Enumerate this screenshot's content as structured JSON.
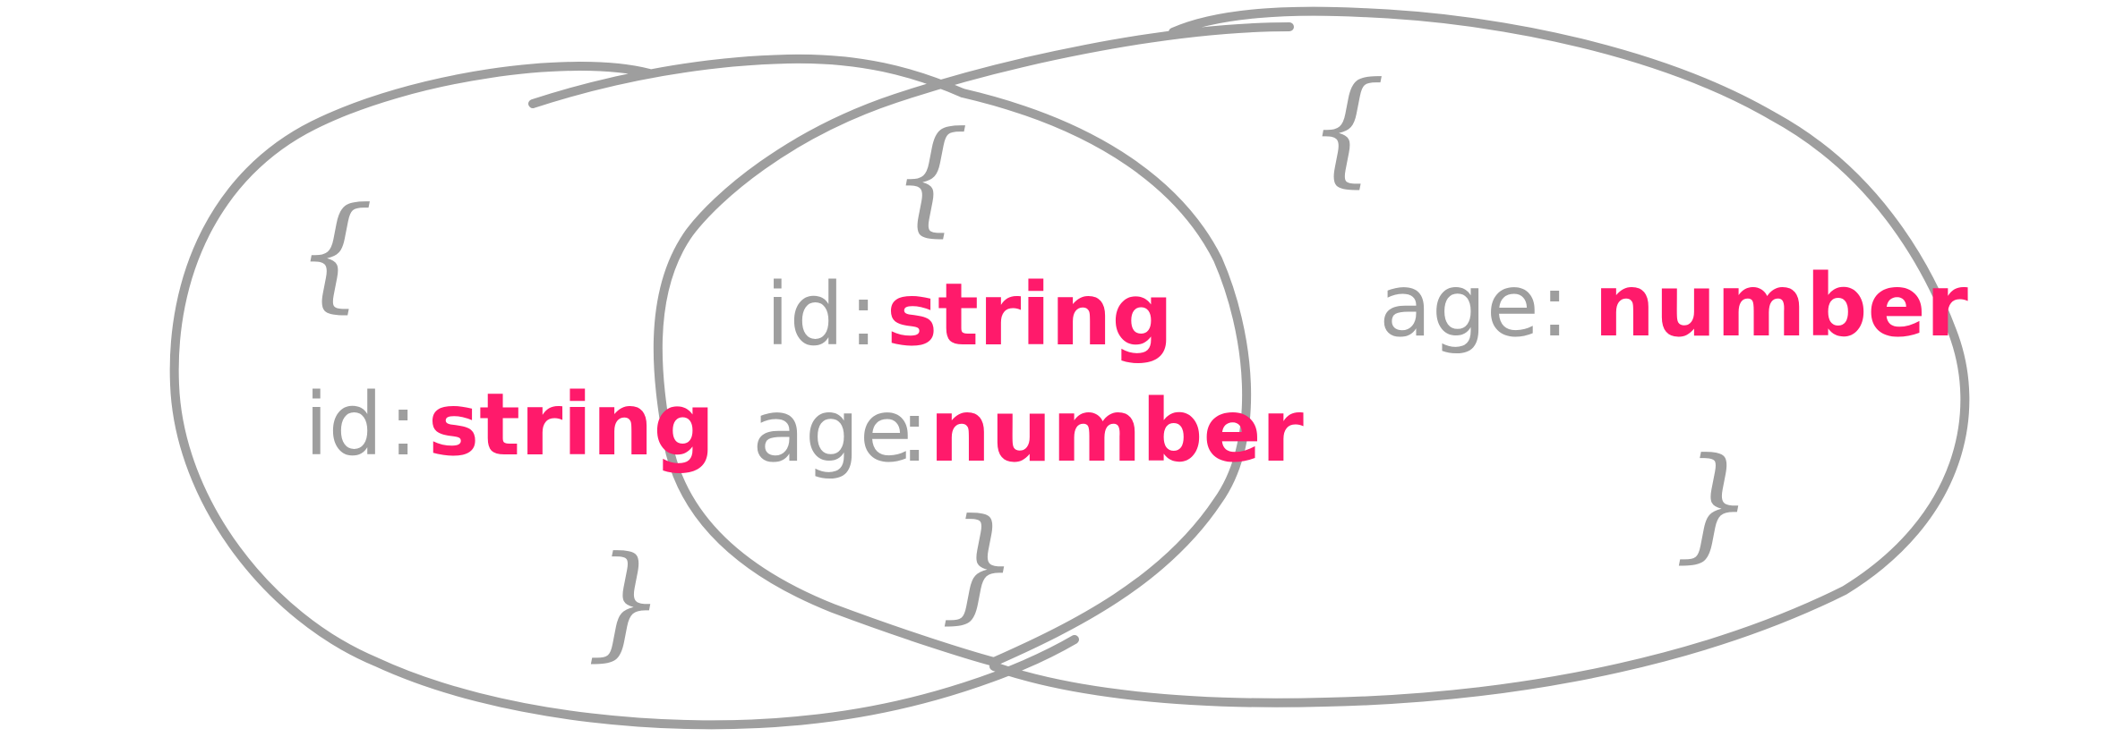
{
  "colors": {
    "outline": "#9e9e9e",
    "key_text": "#9e9e9e",
    "type_text": "#ff1a6b",
    "background": "#ffffff"
  },
  "diagram": {
    "left_set": {
      "open_brace": "{",
      "fields": [
        {
          "key": "id",
          "separator": ":",
          "type": "string"
        }
      ],
      "close_brace": "}"
    },
    "intersection": {
      "open_brace": "{",
      "fields": [
        {
          "key": "id",
          "separator": ":",
          "type": "string"
        },
        {
          "key": "age",
          "separator": ":",
          "type": "number"
        }
      ],
      "close_brace": "}"
    },
    "right_set": {
      "open_brace": "{",
      "fields": [
        {
          "key": "age",
          "separator": ":",
          "type": "number"
        }
      ],
      "close_brace": "}"
    }
  }
}
